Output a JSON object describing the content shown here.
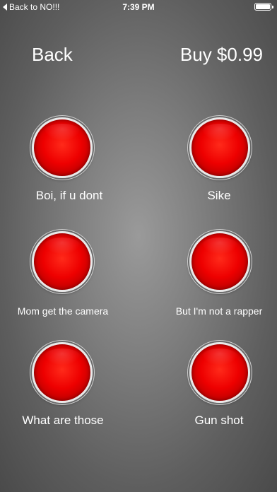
{
  "status_bar": {
    "back_text": "Back to NO!!!",
    "time": "7:39 PM"
  },
  "nav": {
    "back_label": "Back",
    "buy_label": "Buy $0.99"
  },
  "sounds": [
    {
      "label": "Boi, if u dont"
    },
    {
      "label": "Sike"
    },
    {
      "label": "Mom get the camera"
    },
    {
      "label": "But I'm not a rapper"
    },
    {
      "label": "What are those"
    },
    {
      "label": "Gun shot"
    }
  ],
  "colors": {
    "button_red": "#ee0000",
    "text": "#ffffff"
  }
}
